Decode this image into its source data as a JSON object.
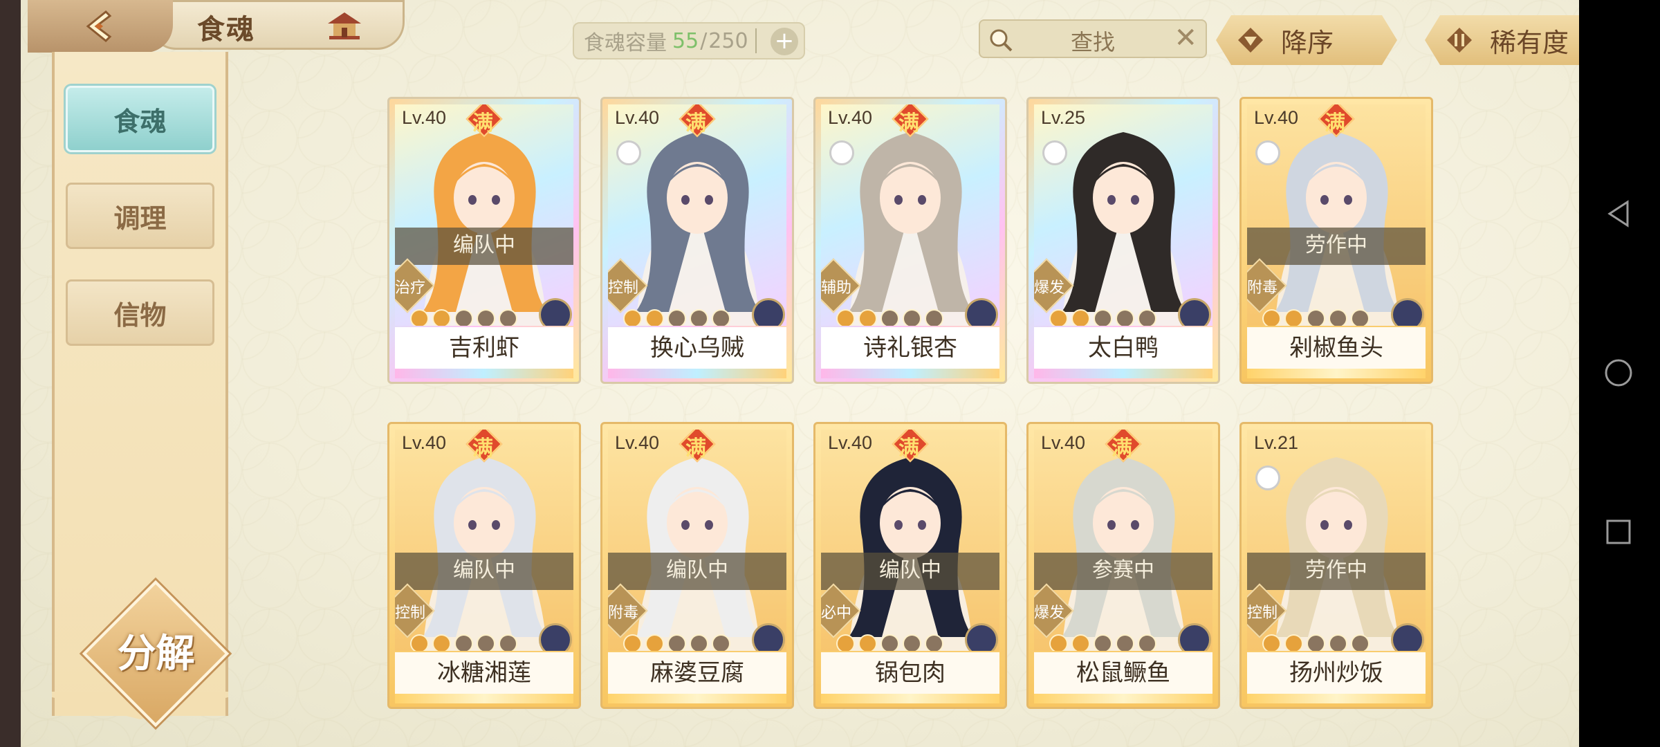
{
  "header": {
    "title": "食魂",
    "capacity_label": "食魂容量",
    "capacity_current": "55",
    "capacity_total": "250",
    "search_placeholder": "查找",
    "sort_order": "降序",
    "sort_key": "稀有度"
  },
  "sidebar": {
    "tabs": [
      {
        "label": "食魂",
        "active": true
      },
      {
        "label": "调理",
        "active": false
      },
      {
        "label": "信物",
        "active": false
      }
    ],
    "decompose_label": "分解"
  },
  "cards": [
    {
      "level": "Lv.40",
      "maxed": "满",
      "status": "编队中",
      "role": "治疗",
      "name": "吉利虾",
      "frame": "rainbow",
      "stars_lit": 2,
      "stars_total": 5,
      "hair": "#f3a545"
    },
    {
      "level": "Lv.40",
      "maxed": "满",
      "status": "",
      "role": "控制",
      "name": "换心乌贼",
      "frame": "rainbow",
      "stars_lit": 2,
      "stars_total": 5,
      "hair": "#6f7a90"
    },
    {
      "level": "Lv.40",
      "maxed": "满",
      "status": "",
      "role": "辅助",
      "name": "诗礼银杏",
      "frame": "rainbow",
      "stars_lit": 2,
      "stars_total": 5,
      "hair": "#bfb5a8"
    },
    {
      "level": "Lv.25",
      "maxed": "",
      "status": "",
      "role": "爆发",
      "name": "太白鸭",
      "frame": "rainbow",
      "stars_lit": 2,
      "stars_total": 5,
      "hair": "#2f2a28"
    },
    {
      "level": "Lv.40",
      "maxed": "满",
      "status": "劳作中",
      "role": "附毒",
      "name": "剁椒鱼头",
      "frame": "gold",
      "stars_lit": 2,
      "stars_total": 5,
      "hair": "#cfd6e0"
    },
    {
      "level": "Lv.40",
      "maxed": "满",
      "status": "编队中",
      "role": "控制",
      "name": "冰糖湘莲",
      "frame": "gold",
      "stars_lit": 2,
      "stars_total": 5,
      "hair": "#dfe3ea"
    },
    {
      "level": "Lv.40",
      "maxed": "满",
      "status": "编队中",
      "role": "附毒",
      "name": "麻婆豆腐",
      "frame": "gold",
      "stars_lit": 2,
      "stars_total": 5,
      "hair": "#eeeeee"
    },
    {
      "level": "Lv.40",
      "maxed": "满",
      "status": "编队中",
      "role": "必中",
      "name": "锅包肉",
      "frame": "gold",
      "stars_lit": 2,
      "stars_total": 5,
      "hair": "#1f2438"
    },
    {
      "level": "Lv.40",
      "maxed": "满",
      "status": "参赛中",
      "role": "爆发",
      "name": "松鼠鳜鱼",
      "frame": "gold",
      "stars_lit": 2,
      "stars_total": 5,
      "hair": "#d7d8cf"
    },
    {
      "level": "Lv.21",
      "maxed": "",
      "status": "劳作中",
      "role": "控制",
      "name": "扬州炒饭",
      "frame": "gold",
      "stars_lit": 2,
      "stars_total": 5,
      "hair": "#e8d9b8"
    }
  ],
  "icons": {
    "back": "back-arrow-icon",
    "home": "house-icon",
    "search": "magnifier-icon",
    "clear": "close-icon",
    "sort_order": "triangle-down-icon",
    "sort_key": "sort-arrows-icon"
  }
}
